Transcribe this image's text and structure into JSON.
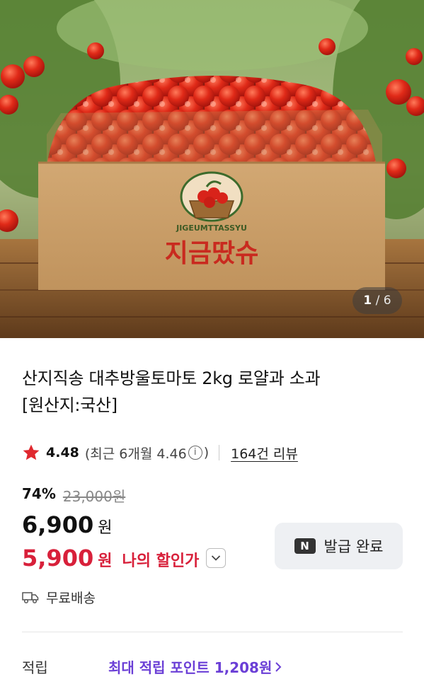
{
  "gallery": {
    "current": "1",
    "separator": "/",
    "total": "6",
    "box_brand_en": "JIGEUMTTASSYU",
    "box_brand_ko": "지금땄슈"
  },
  "product": {
    "title_line1": "산지직송 대추방울토마토 2kg 로얄과 소과",
    "title_line2": "[원산지:국산]"
  },
  "rating": {
    "score": "4.48",
    "recent_prefix": "(최근 6개월 4.46",
    "info_glyph": "i",
    "recent_suffix": ")",
    "review_count": "164건 리뷰"
  },
  "price": {
    "discount_pct": "74%",
    "original": "23,000원",
    "sale": "6,900",
    "won": "원",
    "my_price": "5,900",
    "my_won": "원",
    "my_label": "나의 할인가"
  },
  "coupon": {
    "badge": "N",
    "label": "발급 완료"
  },
  "shipping": {
    "label": "무료배송"
  },
  "points": {
    "label": "적립",
    "link": "최대 적립 포인트 1,208원"
  },
  "colors": {
    "accent_red": "#d8203a",
    "points_purple": "#6b3fd6",
    "star_red": "#e0282e"
  }
}
